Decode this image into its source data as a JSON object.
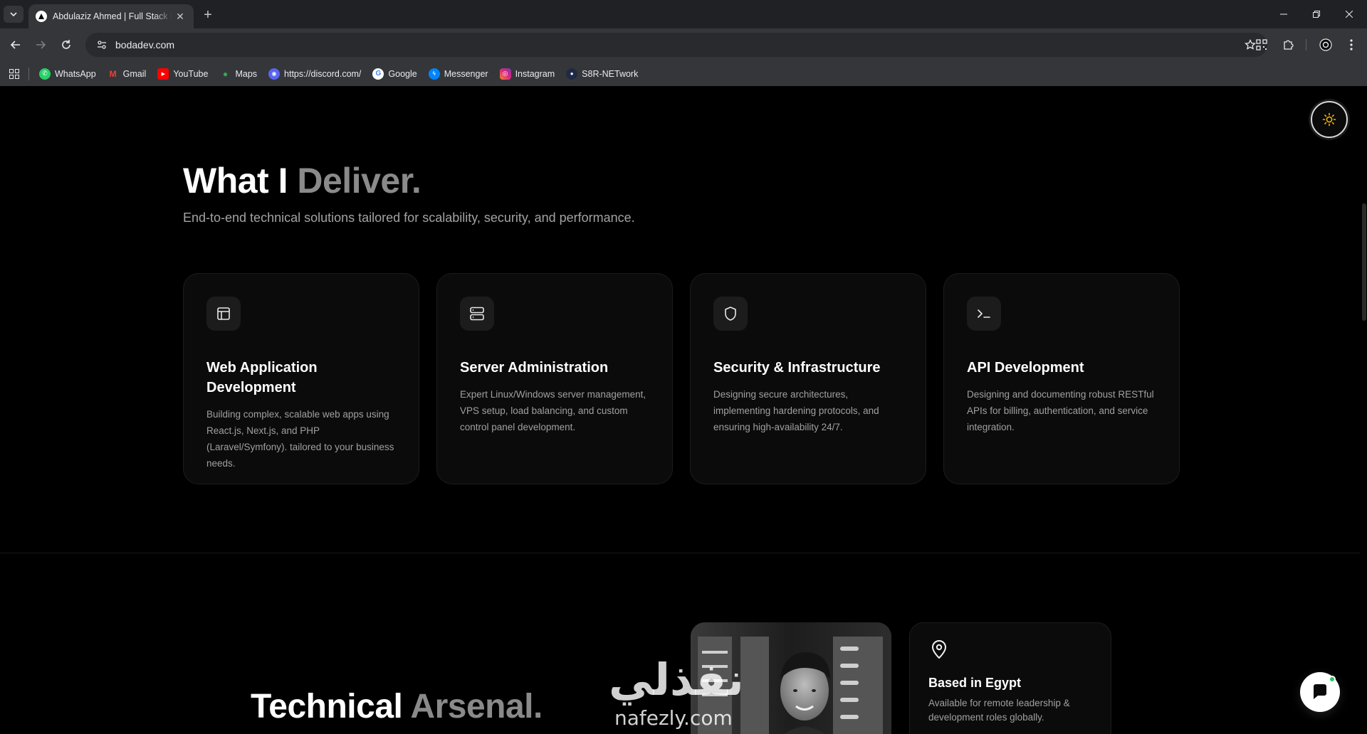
{
  "browser": {
    "tab_title": "Abdulaziz Ahmed | Full Stack Developer",
    "url": "bodadev.com",
    "bookmarks": [
      {
        "label": "WhatsApp",
        "color": "#25D366"
      },
      {
        "label": "Gmail",
        "color": "#EA4335"
      },
      {
        "label": "YouTube",
        "color": "#FF0000"
      },
      {
        "label": "Maps",
        "color": "#34A853"
      },
      {
        "label": "https://discord.com/",
        "color": "#5865F2"
      },
      {
        "label": "Google",
        "color": "#4285F4"
      },
      {
        "label": "Messenger",
        "color": "#0084FF"
      },
      {
        "label": "Instagram",
        "color": "#E1306C"
      },
      {
        "label": "S8R-NETwork",
        "color": "#1f2a44"
      }
    ]
  },
  "section": {
    "title_main": "What I ",
    "title_accent": "Deliver.",
    "subtitle": "End-to-end technical solutions tailored for scalability, security, and performance.",
    "cards": [
      {
        "icon": "layout-icon",
        "title": "Web Application Development",
        "desc": "Building complex, scalable web apps using React.js, Next.js, and PHP (Laravel/Symfony). tailored to your business needs."
      },
      {
        "icon": "server-icon",
        "title": "Server Administration",
        "desc": "Expert Linux/Windows server management, VPS setup, load balancing, and custom control panel development."
      },
      {
        "icon": "shield-icon",
        "title": "Security & Infrastructure",
        "desc": "Designing secure architectures, implementing hardening protocols, and ensuring high-availability 24/7."
      },
      {
        "icon": "terminal-icon",
        "title": "API Development",
        "desc": "Designing and documenting robust RESTful APIs for billing, authentication, and service integration."
      }
    ]
  },
  "arsenal": {
    "title_main": "Technical ",
    "title_accent": "Arsenal."
  },
  "location": {
    "title": "Based in Egypt",
    "desc": "Available for remote leadership & development roles globally."
  },
  "watermark": {
    "arabic": "نفذلي",
    "latin": "nafezly.com"
  },
  "colors": {
    "accent_sun": "#f5b301",
    "muted_heading": "#8a8a8a",
    "status_online": "#22c55e"
  }
}
